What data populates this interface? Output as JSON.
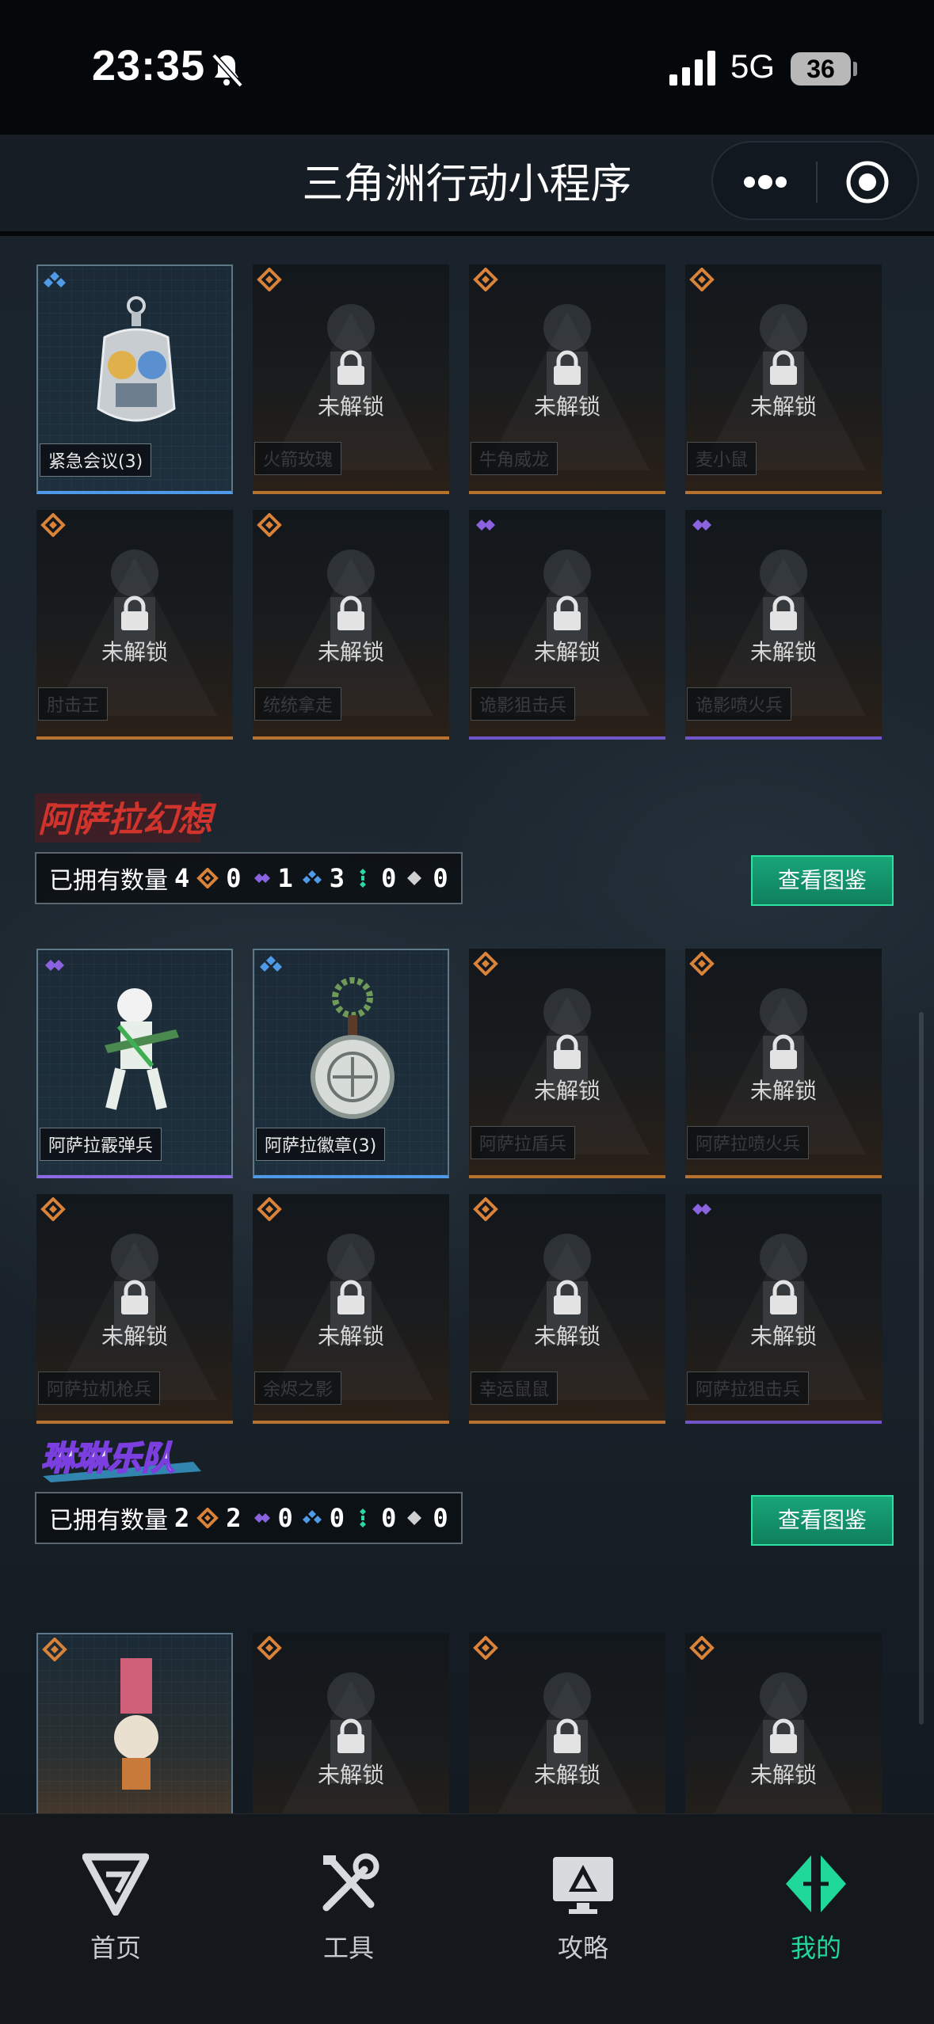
{
  "status_bar": {
    "time": "23:35",
    "network": "5G",
    "battery": "36"
  },
  "header": {
    "title": "三角洲行动小程序"
  },
  "top_grid": {
    "items": [
      {
        "name": "紧急会议(3)",
        "rarity": "blue",
        "owned": true
      },
      {
        "name": "火箭玫瑰",
        "rarity": "orange",
        "owned": false
      },
      {
        "name": "牛角威龙",
        "rarity": "orange",
        "owned": false
      },
      {
        "name": "麦小鼠",
        "rarity": "orange",
        "owned": false
      },
      {
        "name": "肘击王",
        "rarity": "orange",
        "owned": false
      },
      {
        "name": "统统拿走",
        "rarity": "orange",
        "owned": false
      },
      {
        "name": "诡影狙击兵",
        "rarity": "purple",
        "owned": false
      },
      {
        "name": "诡影喷火兵",
        "rarity": "purple",
        "owned": false
      }
    ]
  },
  "sections": [
    {
      "logo_text": "阿萨拉幻想",
      "owned_label": "已拥有数量",
      "owned_count": "4",
      "counts": {
        "orange": "0",
        "purple": "1",
        "blue": "3",
        "green": "0",
        "white": "0"
      },
      "button_label": "查看图鉴",
      "items": [
        {
          "name": "阿萨拉霰弹兵",
          "rarity": "purple",
          "owned": true
        },
        {
          "name": "阿萨拉徽章(3)",
          "rarity": "blue",
          "owned": true
        },
        {
          "name": "阿萨拉盾兵",
          "rarity": "orange",
          "owned": false
        },
        {
          "name": "阿萨拉喷火兵",
          "rarity": "orange",
          "owned": false
        },
        {
          "name": "阿萨拉机枪兵",
          "rarity": "orange",
          "owned": false
        },
        {
          "name": "余烬之影",
          "rarity": "orange",
          "owned": false
        },
        {
          "name": "幸运鼠鼠",
          "rarity": "orange",
          "owned": false
        },
        {
          "name": "阿萨拉狙击兵",
          "rarity": "purple",
          "owned": false
        }
      ]
    },
    {
      "logo_text": "琳琳乐队",
      "owned_label": "已拥有数量",
      "owned_count": "2",
      "counts": {
        "orange": "2",
        "purple": "0",
        "blue": "0",
        "green": "0",
        "white": "0"
      },
      "button_label": "查看图鉴",
      "items": [
        {
          "name": "",
          "rarity": "orange",
          "owned": true
        },
        {
          "name": "",
          "rarity": "orange",
          "owned": false
        },
        {
          "name": "",
          "rarity": "orange",
          "owned": false
        },
        {
          "name": "",
          "rarity": "orange",
          "owned": false
        }
      ]
    }
  ],
  "locked_label": "未解锁",
  "colors": {
    "orange": "#d9823a",
    "purple": "#8b63e0",
    "blue": "#4f9be8",
    "green": "#2fd7a0",
    "white": "#d0d0d0",
    "accent": "#1fd89a"
  },
  "tabs": [
    {
      "label": "首页",
      "icon": "home-icon",
      "active": false
    },
    {
      "label": "工具",
      "icon": "tools-icon",
      "active": false
    },
    {
      "label": "攻略",
      "icon": "guide-icon",
      "active": false
    },
    {
      "label": "我的",
      "icon": "profile-icon",
      "active": true
    }
  ]
}
